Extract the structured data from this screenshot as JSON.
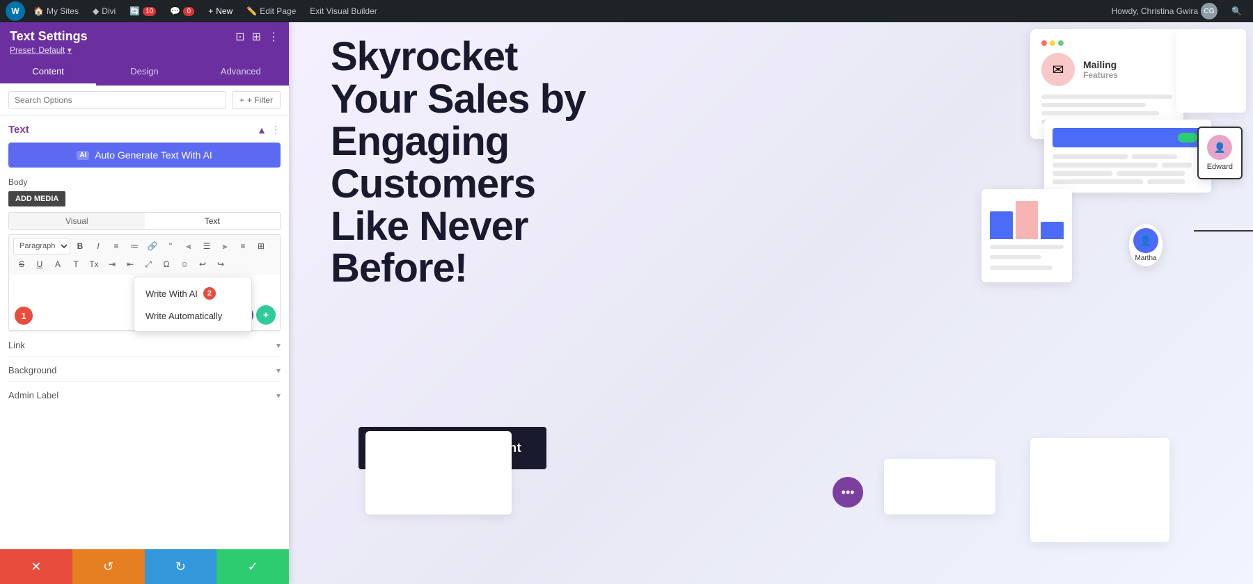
{
  "admin_bar": {
    "wp_label": "W",
    "my_sites": "My Sites",
    "divi": "Divi",
    "updates_count": "10",
    "comments": "0",
    "new_label": "New",
    "edit_page": "Edit Page",
    "exit_builder": "Exit Visual Builder",
    "user_greeting": "Howdy, Christina Gwira",
    "search_icon": "🔍"
  },
  "panel": {
    "title": "Text Settings",
    "preset": "Preset: Default",
    "tabs": [
      "Content",
      "Design",
      "Advanced"
    ],
    "active_tab": "Content",
    "search_placeholder": "Search Options",
    "filter_label": "+ Filter",
    "text_section": {
      "title": "Text",
      "ai_button": "Auto Generate Text With AI",
      "ai_badge": "AI",
      "body_label": "Body",
      "add_media": "ADD MEDIA",
      "editor_tabs": [
        "Visual",
        "Text"
      ],
      "active_editor_tab": "Text",
      "paragraph_select": "Paragraph"
    },
    "tooltip": {
      "write_with_ai": "Write With AI",
      "write_automatically": "Write Automatically",
      "badge": "2"
    },
    "link_section": "Link",
    "background_section": "Background",
    "admin_label_section": "Admin Label",
    "bottom_buttons": {
      "cancel": "✕",
      "undo": "↺",
      "redo": "↻",
      "save": "✓"
    }
  },
  "canvas": {
    "headline_line1": "Skyrocket",
    "headline_line2": "Your Sales by",
    "headline_line3": "Engaging",
    "headline_line4": "Customers",
    "headline_line5": "Like Never",
    "headline_line6": "Before!",
    "book_btn": "Book An Appointment",
    "mailing": {
      "title": "Mailing",
      "subtitle": "Features"
    },
    "avatars": {
      "edward": "Edward",
      "martha": "Martha"
    }
  }
}
